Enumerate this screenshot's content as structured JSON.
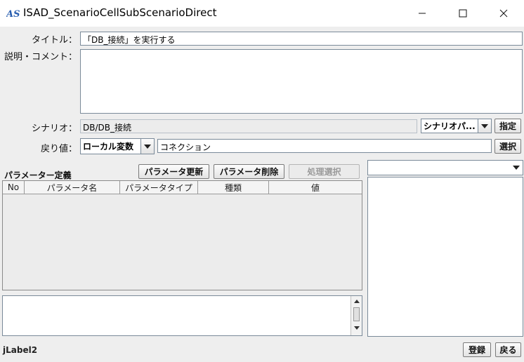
{
  "window": {
    "title": "ISAD_ScenarioCellSubScenarioDirect",
    "icon": "app-logo-icon",
    "controls": [
      "minimize-icon",
      "maximize-icon",
      "close-icon"
    ]
  },
  "form": {
    "title_label": "タイトル：",
    "title_value": "「DB_接続」を実行する",
    "comment_label": "説明・コメント：",
    "comment_value": "",
    "scenario_label": "シナリオ：",
    "scenario_value": "DB/DB_接続",
    "scenario_combo": "シナリオパ...",
    "scenario_button": "指定",
    "return_label": "戻り値：",
    "return_combo": "ローカル変数",
    "return_value": "コネクション",
    "return_button": "選択"
  },
  "params": {
    "heading": "パラメーター定義",
    "update_button": "パラメータ更新",
    "delete_button": "パラメータ削除",
    "process_button": "処理選択",
    "columns": [
      "No",
      "パラメータ名",
      "パラメータタイプ",
      "種類",
      "値"
    ],
    "rows": []
  },
  "right_panel": {
    "combo_value": ""
  },
  "footer": {
    "status": "jLabel2",
    "register_button": "登録",
    "back_button": "戻る"
  },
  "colors": {
    "background": "#eeeeee",
    "field_border": "#7a8a99"
  }
}
